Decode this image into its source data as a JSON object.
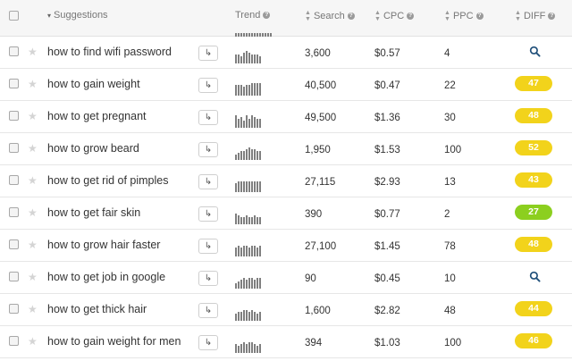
{
  "header": {
    "suggestions_label": "Suggestions",
    "trend_label": "Trend",
    "search_label": "Search",
    "cpc_label": "CPC",
    "ppc_label": "PPC",
    "diff_label": "DIFF"
  },
  "colors": {
    "diff_yellow": "#f2d31b",
    "diff_green": "#8ccf1f",
    "accent": "#1e4e79"
  },
  "rows": [
    {
      "keyword": "how to find wifi password",
      "search": "3,600",
      "cpc": "$0.57",
      "ppc": "4",
      "diff": "",
      "diff_type": "search-icon",
      "trend": [
        5,
        5,
        4,
        6,
        7,
        6,
        5,
        5,
        5,
        4
      ]
    },
    {
      "keyword": "how to gain weight",
      "search": "40,500",
      "cpc": "$0.47",
      "ppc": "22",
      "diff": "47",
      "diff_type": "yellow",
      "trend": [
        6,
        6,
        6,
        5,
        6,
        6,
        7,
        7,
        7,
        7
      ]
    },
    {
      "keyword": "how to get pregnant",
      "search": "49,500",
      "cpc": "$1.36",
      "ppc": "30",
      "diff": "48",
      "diff_type": "yellow",
      "trend": [
        7,
        5,
        6,
        4,
        7,
        5,
        7,
        6,
        5,
        5
      ]
    },
    {
      "keyword": "how to grow beard",
      "search": "1,950",
      "cpc": "$1.53",
      "ppc": "100",
      "diff": "52",
      "diff_type": "yellow",
      "trend": [
        3,
        4,
        5,
        5,
        6,
        7,
        6,
        6,
        5,
        5
      ]
    },
    {
      "keyword": "how to get rid of pimples",
      "search": "27,115",
      "cpc": "$2.93",
      "ppc": "13",
      "diff": "43",
      "diff_type": "yellow",
      "trend": [
        5,
        6,
        6,
        6,
        6,
        6,
        6,
        6,
        6,
        6
      ]
    },
    {
      "keyword": "how to get fair skin",
      "search": "390",
      "cpc": "$0.77",
      "ppc": "2",
      "diff": "27",
      "diff_type": "green",
      "trend": [
        6,
        5,
        4,
        4,
        5,
        4,
        4,
        5,
        4,
        4
      ]
    },
    {
      "keyword": "how to grow hair faster",
      "search": "27,100",
      "cpc": "$1.45",
      "ppc": "78",
      "diff": "48",
      "diff_type": "yellow",
      "trend": [
        5,
        6,
        5,
        6,
        6,
        5,
        6,
        6,
        5,
        6
      ]
    },
    {
      "keyword": "how to get job in google",
      "search": "90",
      "cpc": "$0.45",
      "ppc": "10",
      "diff": "",
      "diff_type": "search-icon",
      "trend": [
        3,
        4,
        5,
        6,
        5,
        6,
        6,
        5,
        6,
        6
      ]
    },
    {
      "keyword": "how to get thick hair",
      "search": "1,600",
      "cpc": "$2.82",
      "ppc": "48",
      "diff": "44",
      "diff_type": "yellow",
      "trend": [
        4,
        5,
        5,
        6,
        6,
        5,
        6,
        5,
        4,
        5
      ]
    },
    {
      "keyword": "how to gain weight for men",
      "search": "394",
      "cpc": "$1.03",
      "ppc": "100",
      "diff": "46",
      "diff_type": "yellow",
      "trend": [
        5,
        4,
        5,
        6,
        5,
        6,
        6,
        5,
        4,
        5
      ]
    }
  ]
}
